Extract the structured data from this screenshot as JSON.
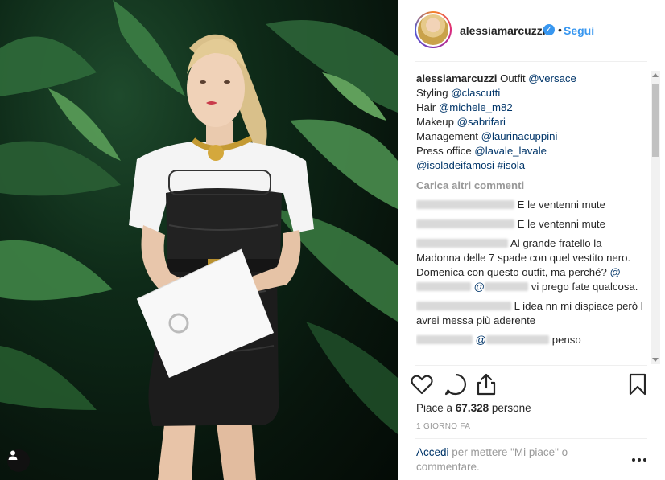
{
  "header": {
    "username": "alessiamarcuzzi",
    "verified_mark": "✓",
    "separator": "•",
    "follow_label": "Segui"
  },
  "caption": {
    "username": "alessiamarcuzzi",
    "lines": [
      {
        "text": "Outfit ",
        "mention": "@versace"
      },
      {
        "text": "Styling ",
        "mention": "@clascutti"
      },
      {
        "text": "Hair ",
        "mention": "@michele_m82"
      },
      {
        "text": "Makeup ",
        "mention": "@sabrifari"
      },
      {
        "text": "Management ",
        "mention": "@laurinacuppini"
      },
      {
        "text": "Press office ",
        "mention": "@lavale_lavale"
      },
      {
        "text": "",
        "mention": "@isoladeifamosi #isola"
      }
    ]
  },
  "load_more_label": "Carica altri commenti",
  "comments": [
    {
      "text": "E le ventenni mute"
    },
    {
      "text": "E le ventenni mute"
    },
    {
      "text": "Al grande fratello la Madonna delle 7 spade con quel vestito nero. Domenica con questo outfit, ma perché?",
      "tail": "vi prego fate qualcosa."
    },
    {
      "text": "L idea nn mi dispiace però l avrei messa più aderente"
    },
    {
      "text": "penso"
    }
  ],
  "likes": {
    "prefix": "Piace a",
    "count": "67.328",
    "suffix": "persone"
  },
  "time_ago": "1 GIORNO FA",
  "login": {
    "link": "Accedi",
    "rest": "per mettere \"Mi piace\" o commentare."
  },
  "icons": [
    "heart-icon",
    "comment-icon",
    "share-icon",
    "bookmark-icon",
    "more-icon",
    "user-tag-icon"
  ],
  "colors": {
    "link": "#3897f0",
    "mention": "#003569",
    "muted": "#999999",
    "verified": "#3897f0"
  }
}
